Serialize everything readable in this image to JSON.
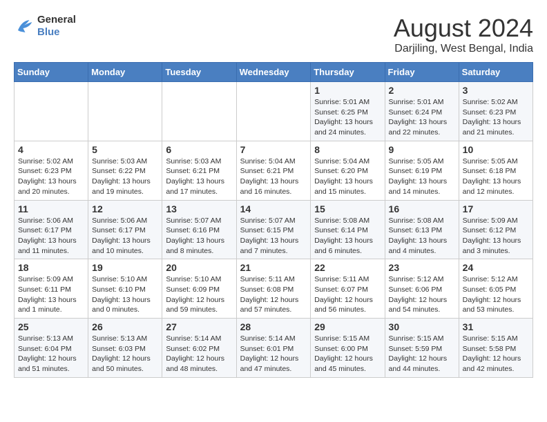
{
  "logo": {
    "text_general": "General",
    "text_blue": "Blue"
  },
  "header": {
    "month_year": "August 2024",
    "location": "Darjiling, West Bengal, India"
  },
  "days_of_week": [
    "Sunday",
    "Monday",
    "Tuesday",
    "Wednesday",
    "Thursday",
    "Friday",
    "Saturday"
  ],
  "weeks": [
    [
      {
        "day": "",
        "info": ""
      },
      {
        "day": "",
        "info": ""
      },
      {
        "day": "",
        "info": ""
      },
      {
        "day": "",
        "info": ""
      },
      {
        "day": "1",
        "info": "Sunrise: 5:01 AM\nSunset: 6:25 PM\nDaylight: 13 hours\nand 24 minutes."
      },
      {
        "day": "2",
        "info": "Sunrise: 5:01 AM\nSunset: 6:24 PM\nDaylight: 13 hours\nand 22 minutes."
      },
      {
        "day": "3",
        "info": "Sunrise: 5:02 AM\nSunset: 6:23 PM\nDaylight: 13 hours\nand 21 minutes."
      }
    ],
    [
      {
        "day": "4",
        "info": "Sunrise: 5:02 AM\nSunset: 6:23 PM\nDaylight: 13 hours\nand 20 minutes."
      },
      {
        "day": "5",
        "info": "Sunrise: 5:03 AM\nSunset: 6:22 PM\nDaylight: 13 hours\nand 19 minutes."
      },
      {
        "day": "6",
        "info": "Sunrise: 5:03 AM\nSunset: 6:21 PM\nDaylight: 13 hours\nand 17 minutes."
      },
      {
        "day": "7",
        "info": "Sunrise: 5:04 AM\nSunset: 6:21 PM\nDaylight: 13 hours\nand 16 minutes."
      },
      {
        "day": "8",
        "info": "Sunrise: 5:04 AM\nSunset: 6:20 PM\nDaylight: 13 hours\nand 15 minutes."
      },
      {
        "day": "9",
        "info": "Sunrise: 5:05 AM\nSunset: 6:19 PM\nDaylight: 13 hours\nand 14 minutes."
      },
      {
        "day": "10",
        "info": "Sunrise: 5:05 AM\nSunset: 6:18 PM\nDaylight: 13 hours\nand 12 minutes."
      }
    ],
    [
      {
        "day": "11",
        "info": "Sunrise: 5:06 AM\nSunset: 6:17 PM\nDaylight: 13 hours\nand 11 minutes."
      },
      {
        "day": "12",
        "info": "Sunrise: 5:06 AM\nSunset: 6:17 PM\nDaylight: 13 hours\nand 10 minutes."
      },
      {
        "day": "13",
        "info": "Sunrise: 5:07 AM\nSunset: 6:16 PM\nDaylight: 13 hours\nand 8 minutes."
      },
      {
        "day": "14",
        "info": "Sunrise: 5:07 AM\nSunset: 6:15 PM\nDaylight: 13 hours\nand 7 minutes."
      },
      {
        "day": "15",
        "info": "Sunrise: 5:08 AM\nSunset: 6:14 PM\nDaylight: 13 hours\nand 6 minutes."
      },
      {
        "day": "16",
        "info": "Sunrise: 5:08 AM\nSunset: 6:13 PM\nDaylight: 13 hours\nand 4 minutes."
      },
      {
        "day": "17",
        "info": "Sunrise: 5:09 AM\nSunset: 6:12 PM\nDaylight: 13 hours\nand 3 minutes."
      }
    ],
    [
      {
        "day": "18",
        "info": "Sunrise: 5:09 AM\nSunset: 6:11 PM\nDaylight: 13 hours\nand 1 minute."
      },
      {
        "day": "19",
        "info": "Sunrise: 5:10 AM\nSunset: 6:10 PM\nDaylight: 13 hours\nand 0 minutes."
      },
      {
        "day": "20",
        "info": "Sunrise: 5:10 AM\nSunset: 6:09 PM\nDaylight: 12 hours\nand 59 minutes."
      },
      {
        "day": "21",
        "info": "Sunrise: 5:11 AM\nSunset: 6:08 PM\nDaylight: 12 hours\nand 57 minutes."
      },
      {
        "day": "22",
        "info": "Sunrise: 5:11 AM\nSunset: 6:07 PM\nDaylight: 12 hours\nand 56 minutes."
      },
      {
        "day": "23",
        "info": "Sunrise: 5:12 AM\nSunset: 6:06 PM\nDaylight: 12 hours\nand 54 minutes."
      },
      {
        "day": "24",
        "info": "Sunrise: 5:12 AM\nSunset: 6:05 PM\nDaylight: 12 hours\nand 53 minutes."
      }
    ],
    [
      {
        "day": "25",
        "info": "Sunrise: 5:13 AM\nSunset: 6:04 PM\nDaylight: 12 hours\nand 51 minutes."
      },
      {
        "day": "26",
        "info": "Sunrise: 5:13 AM\nSunset: 6:03 PM\nDaylight: 12 hours\nand 50 minutes."
      },
      {
        "day": "27",
        "info": "Sunrise: 5:14 AM\nSunset: 6:02 PM\nDaylight: 12 hours\nand 48 minutes."
      },
      {
        "day": "28",
        "info": "Sunrise: 5:14 AM\nSunset: 6:01 PM\nDaylight: 12 hours\nand 47 minutes."
      },
      {
        "day": "29",
        "info": "Sunrise: 5:15 AM\nSunset: 6:00 PM\nDaylight: 12 hours\nand 45 minutes."
      },
      {
        "day": "30",
        "info": "Sunrise: 5:15 AM\nSunset: 5:59 PM\nDaylight: 12 hours\nand 44 minutes."
      },
      {
        "day": "31",
        "info": "Sunrise: 5:15 AM\nSunset: 5:58 PM\nDaylight: 12 hours\nand 42 minutes."
      }
    ]
  ]
}
